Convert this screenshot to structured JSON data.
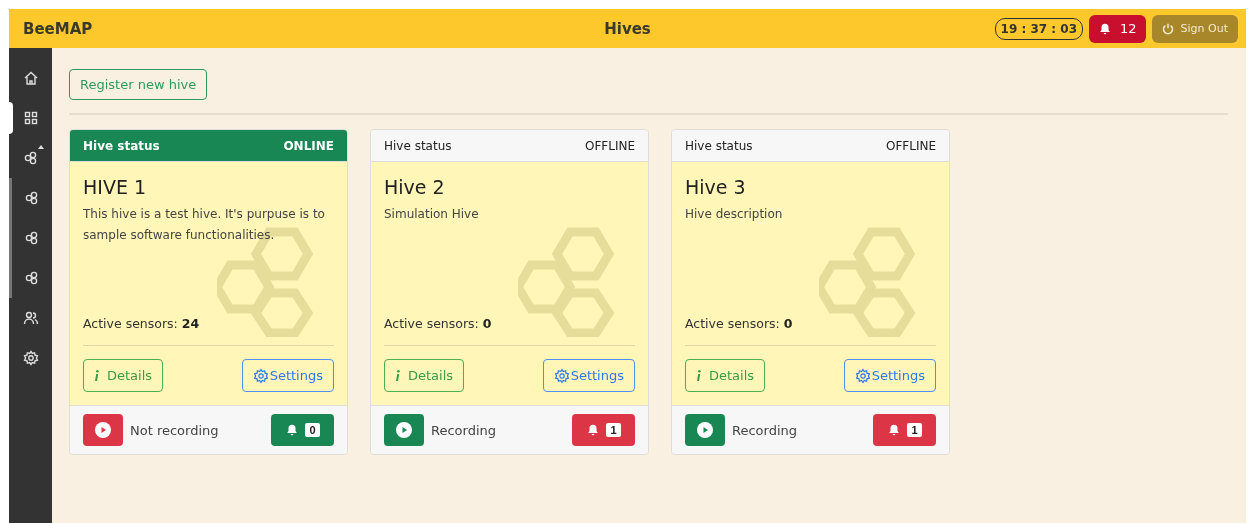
{
  "header": {
    "brand": "BeeMAP",
    "title": "Hives",
    "clock": "19 : 37 : 03",
    "alerts": "12",
    "sign_out": "Sign Out"
  },
  "sidebar": {
    "items": [
      {
        "selected": false
      },
      {
        "selected": true
      },
      {
        "selected": false,
        "expanded": true,
        "children": [
          {
            "selected": false
          },
          {
            "selected": false
          },
          {
            "selected": false
          }
        ]
      },
      {
        "selected": false
      },
      {
        "selected": false
      }
    ]
  },
  "register_button": "Register new hive",
  "hives": [
    {
      "status_label": "Hive status",
      "status": "ONLINE",
      "online": true,
      "name": "HIVE 1",
      "description": "This hive is a test hive. It's purpuse is to sample software functionalities.",
      "sensors_label": "Active sensors:",
      "sensors": "24",
      "details": "Details",
      "settings": "Settings",
      "recording": false,
      "recording_label": "Not recording",
      "alerting": false,
      "alerts": "0"
    },
    {
      "status_label": "Hive status",
      "status": "OFFLINE",
      "online": false,
      "name": "Hive 2",
      "description": "Simulation Hive",
      "sensors_label": "Active sensors:",
      "sensors": "0",
      "details": "Details",
      "settings": "Settings",
      "recording": true,
      "recording_label": "Recording",
      "alerting": true,
      "alerts": "1"
    },
    {
      "status_label": "Hive status",
      "status": "OFFLINE",
      "online": false,
      "name": "Hive 3",
      "description": "Hive description",
      "sensors_label": "Active sensors:",
      "sensors": "0",
      "details": "Details",
      "settings": "Settings",
      "recording": true,
      "recording_label": "Recording",
      "alerting": true,
      "alerts": "1"
    }
  ]
}
